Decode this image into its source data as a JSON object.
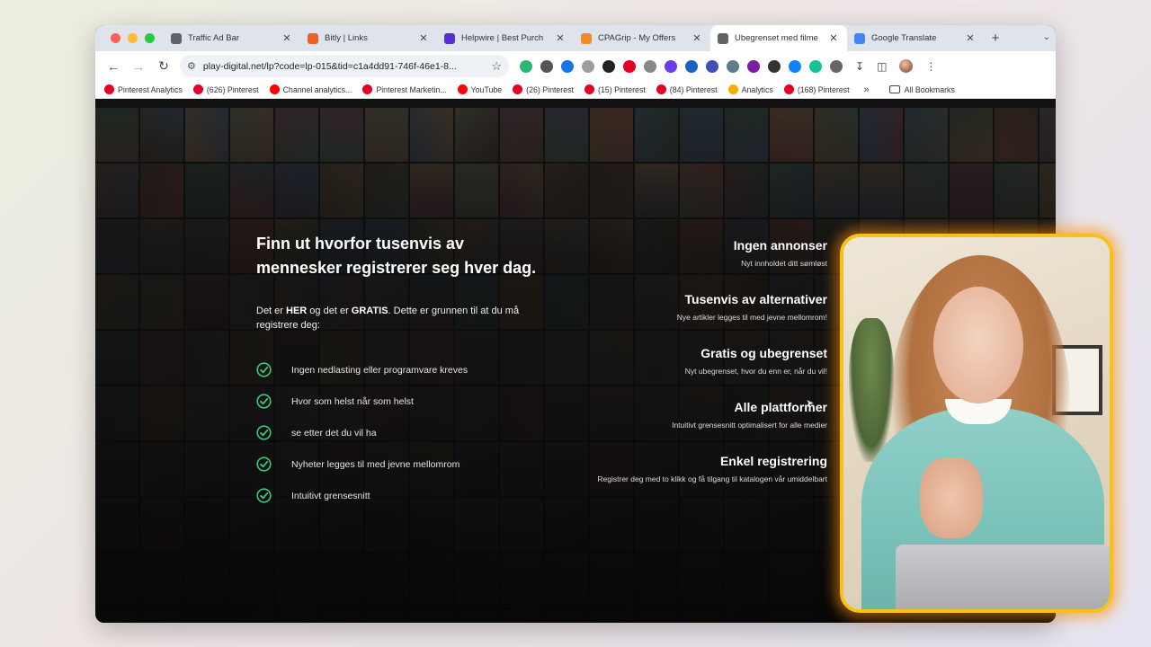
{
  "browser": {
    "tabs": [
      {
        "title": "Traffic Ad Bar",
        "active": false,
        "fav_color": "#5f6368"
      },
      {
        "title": "Bitly | Links",
        "active": false,
        "fav_color": "#ee6123"
      },
      {
        "title": "Helpwire | Best Purch",
        "active": false,
        "fav_color": "#5b2bd6"
      },
      {
        "title": "CPAGrip - My Offers",
        "active": false,
        "fav_color": "#f08a24"
      },
      {
        "title": "Ubegrenset med filme",
        "active": true,
        "fav_color": "#5f6368"
      },
      {
        "title": "Google Translate",
        "active": false,
        "fav_color": "#4285f4"
      }
    ],
    "url": "play-digital.net/lp?code=lp-015&tid=c1a4dd91-746f-46e1-8...",
    "bookmarks": [
      {
        "label": "Pinterest Analytics",
        "color": "#e60023"
      },
      {
        "label": "(626) Pinterest",
        "color": "#e60023"
      },
      {
        "label": "Channel analytics...",
        "color": "#ff0000"
      },
      {
        "label": "Pinterest Marketin...",
        "color": "#e60023"
      },
      {
        "label": "YouTube",
        "color": "#ff0000"
      },
      {
        "label": "(26) Pinterest",
        "color": "#e60023"
      },
      {
        "label": "(15) Pinterest",
        "color": "#e60023"
      },
      {
        "label": "(84) Pinterest",
        "color": "#e60023"
      },
      {
        "label": "Analytics",
        "color": "#f9ab00"
      },
      {
        "label": "(168) Pinterest",
        "color": "#e60023"
      }
    ],
    "all_bookmarks": "All Bookmarks",
    "extensions": [
      "#2bb673",
      "#555555",
      "#1a73e8",
      "#9e9e9e",
      "#222222",
      "#e60023",
      "#888888",
      "#6a3de8",
      "#1565c0",
      "#3f51b5",
      "#607d8b",
      "#7b1fa2",
      "#333333",
      "#0a84ff",
      "#13c296",
      "#666666"
    ]
  },
  "page": {
    "headline": "Finn ut hvorfor tusenvis av mennesker registrerer seg hver dag.",
    "lead_pre": "Det er ",
    "lead_her": "HER",
    "lead_mid": " og det er ",
    "lead_gratis": "GRATIS",
    "lead_post": ". Dette er grunnen til at du må registrere deg:",
    "check_color": "#3ec97a",
    "checks": [
      "Ingen nedlasting eller programvare kreves",
      "Hvor som helst når som helst",
      "se etter det du vil ha",
      "Nyheter legges til med jevne mellomrom",
      "Intuitivt grensesnitt"
    ],
    "features": [
      {
        "title": "Ingen annonser",
        "desc": "Nyt innholdet ditt sømløst"
      },
      {
        "title": "Tusenvis av alternativer",
        "desc": "Nye artikler legges til med jevne mellomrom!"
      },
      {
        "title": "Gratis og ubegrenset",
        "desc": "Nyt ubegrenset, hvor du enn er, når du vil!"
      },
      {
        "title": "Alle plattformer",
        "desc": "Intuitivt grensesnitt optimalisert for alle medier"
      },
      {
        "title": "Enkel registrering",
        "desc": "Registrer deg med to klikk og få tilgang til katalogen vår umiddelbart"
      }
    ]
  },
  "colors": {
    "webcam_border": "#f6c21a"
  }
}
